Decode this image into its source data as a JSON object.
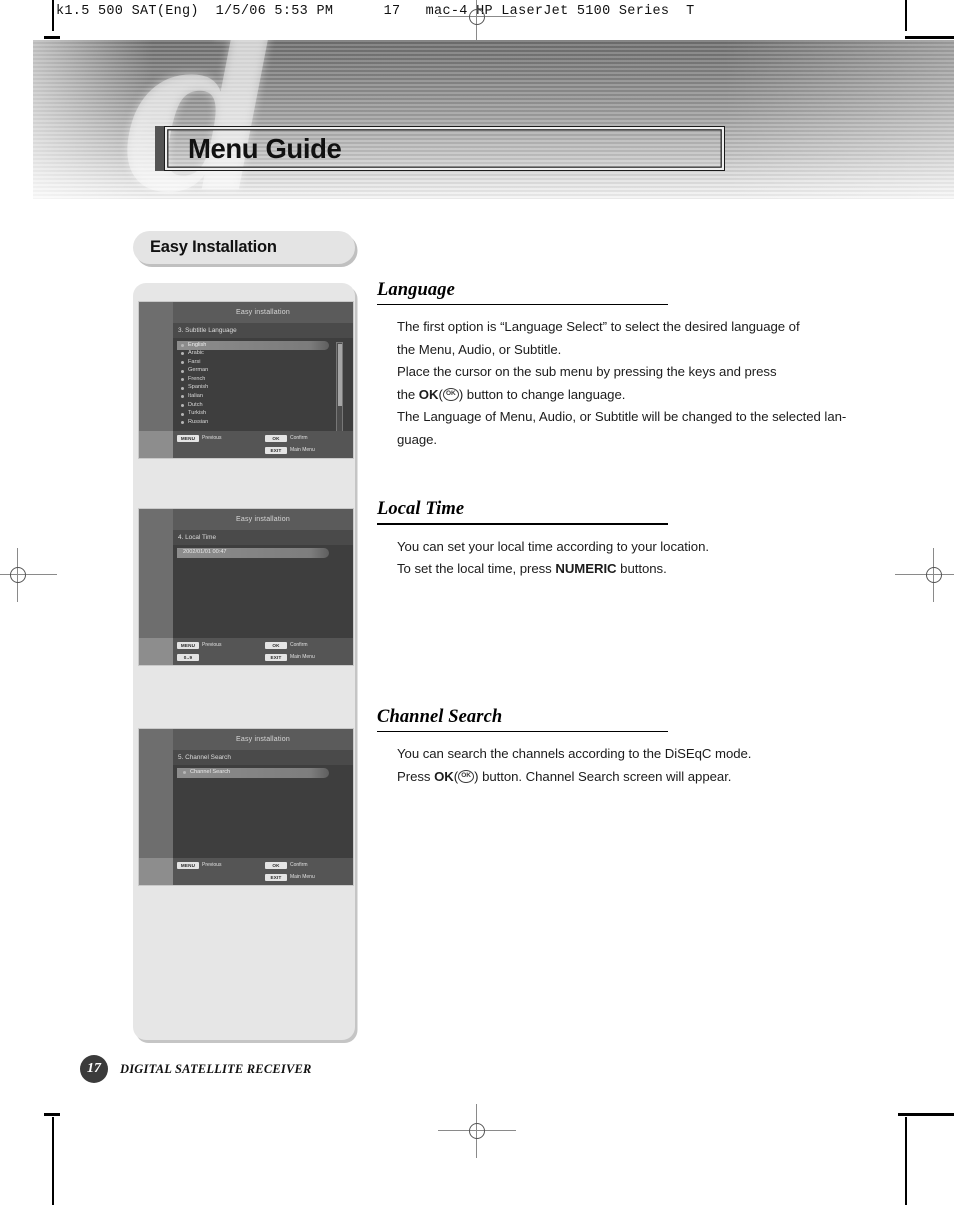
{
  "print_slug": "k1.5 500 SAT(Eng)  1/5/06 5:53 PM      17   mac-4 HP LaserJet 5100 Series  T",
  "header": {
    "title": "Menu Guide",
    "watermark_glyph": "d"
  },
  "section_pill": {
    "label": "Easy Installation"
  },
  "screens": [
    {
      "title": "Easy installation",
      "submenu": "3. Subtitle Language",
      "type": "list",
      "items": [
        "English",
        "Arabic",
        "Farsi",
        "German",
        "French",
        "Spanish",
        "Italian",
        "Dutch",
        "Turkish",
        "Russian"
      ],
      "selected_index": 0,
      "footer_keys": [
        {
          "key": "MENU",
          "desc": "Previous"
        },
        {
          "key": "OK",
          "desc": "Confirm"
        },
        {
          "key": "",
          "desc": ""
        },
        {
          "key": "EXIT",
          "desc": "Main Menu"
        }
      ]
    },
    {
      "title": "Easy installation",
      "submenu": "4. Local Time",
      "type": "value",
      "value": "2002/01/01 00:47",
      "footer_keys": [
        {
          "key": "MENU",
          "desc": "Previous"
        },
        {
          "key": "OK",
          "desc": "Confirm"
        },
        {
          "key": "0..9",
          "desc": ""
        },
        {
          "key": "EXIT",
          "desc": "Main Menu"
        }
      ]
    },
    {
      "title": "Easy installation",
      "submenu": "5. Channel Search",
      "type": "value",
      "value": "Channel Search",
      "footer_keys": [
        {
          "key": "MENU",
          "desc": "Previous"
        },
        {
          "key": "OK",
          "desc": "Confirm"
        },
        {
          "key": "",
          "desc": ""
        },
        {
          "key": "EXIT",
          "desc": "Main Menu"
        }
      ]
    }
  ],
  "sections": [
    {
      "heading": "Language",
      "lines": [
        "The first option is “Language Select” to select the desired language of",
        "the Menu, Audio, or Subtitle.",
        "Place the cursor on the sub menu by pressing the keys and press",
        "the OK(Ⓞ) button to change language.",
        "The Language of Menu, Audio, or Subtitle will be changed to the selected lan-",
        "guage."
      ]
    },
    {
      "heading": "Local Time",
      "lines": [
        "You can set your local time according to your location.",
        "To set the local time, press NUMERIC buttons."
      ]
    },
    {
      "heading": "Channel Search",
      "lines": [
        "You can search the channels according to the DiSEqC mode.",
        "Press OK(Ⓞ) button. Channel Search screen will appear."
      ]
    }
  ],
  "footer": {
    "page_number": "17",
    "label": "DIGITAL SATELLITE RECEIVER"
  },
  "colors": {
    "banner_top": "#6f6f6f",
    "banner_bottom": "#f4f4f4",
    "panel_bg": "#e6e6e6",
    "pill_bg": "#e4e4e4",
    "screen_bg": "#3e3e3e",
    "page_dot": "#3b3b3b"
  }
}
